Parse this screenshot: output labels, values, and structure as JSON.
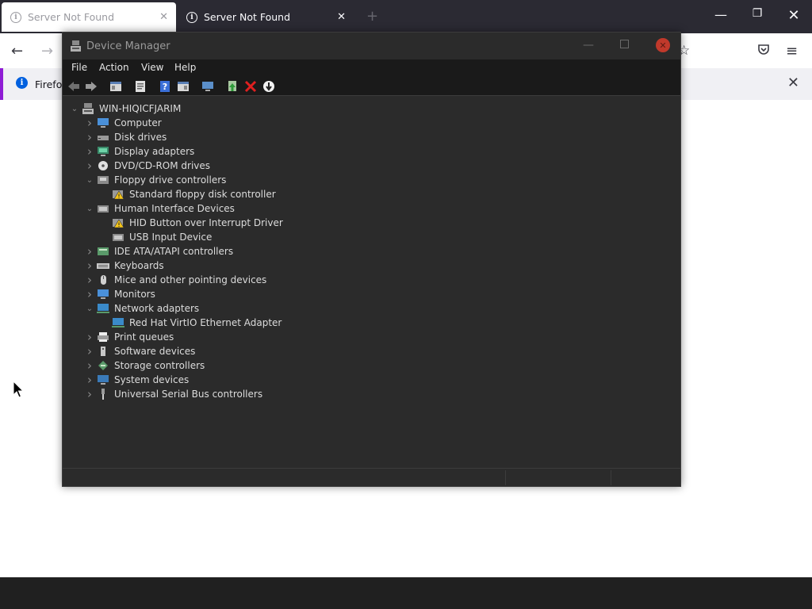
{
  "browser": {
    "tabs": [
      {
        "title": "Server Not Found",
        "active": true
      },
      {
        "title": "Server Not Found",
        "active": false
      }
    ],
    "infobar_text": "Firefox",
    "colors": {
      "tabbar": "#2b2a33",
      "accent": "#8f1cd5"
    }
  },
  "device_manager": {
    "title": "Device Manager",
    "menu": [
      "File",
      "Action",
      "View",
      "Help"
    ],
    "toolbar_icons": [
      "back-arrow-icon",
      "forward-arrow-icon",
      "show-hide-console-tree-icon",
      "properties-icon",
      "help-icon",
      "action-pane-icon",
      "scan-hardware-icon",
      "update-driver-icon",
      "uninstall-icon",
      "disable-device-icon"
    ],
    "root": "WIN-HIQICFJARIM",
    "tree": [
      {
        "label": "Computer",
        "level": 1,
        "expander": "collapsed",
        "icon": "computer-icon"
      },
      {
        "label": "Disk drives",
        "level": 1,
        "expander": "collapsed",
        "icon": "disk-drive-icon"
      },
      {
        "label": "Display adapters",
        "level": 1,
        "expander": "collapsed",
        "icon": "display-adapter-icon"
      },
      {
        "label": "DVD/CD-ROM drives",
        "level": 1,
        "expander": "collapsed",
        "icon": "dvd-icon"
      },
      {
        "label": "Floppy drive controllers",
        "level": 1,
        "expander": "expanded",
        "icon": "floppy-controller-icon"
      },
      {
        "label": "Standard floppy disk controller",
        "level": 2,
        "expander": "none",
        "icon": "warning-device-icon"
      },
      {
        "label": "Human Interface Devices",
        "level": 1,
        "expander": "expanded",
        "icon": "hid-icon"
      },
      {
        "label": "HID Button over Interrupt Driver",
        "level": 2,
        "expander": "none",
        "icon": "warning-device-icon"
      },
      {
        "label": "USB Input Device",
        "level": 2,
        "expander": "none",
        "icon": "hid-icon"
      },
      {
        "label": "IDE ATA/ATAPI controllers",
        "level": 1,
        "expander": "collapsed",
        "icon": "ide-controller-icon"
      },
      {
        "label": "Keyboards",
        "level": 1,
        "expander": "collapsed",
        "icon": "keyboard-icon"
      },
      {
        "label": "Mice and other pointing devices",
        "level": 1,
        "expander": "collapsed",
        "icon": "mouse-icon"
      },
      {
        "label": "Monitors",
        "level": 1,
        "expander": "collapsed",
        "icon": "monitor-icon"
      },
      {
        "label": "Network adapters",
        "level": 1,
        "expander": "expanded",
        "icon": "network-adapter-icon"
      },
      {
        "label": "Red Hat VirtIO Ethernet Adapter",
        "level": 2,
        "expander": "none",
        "icon": "network-adapter-icon"
      },
      {
        "label": "Print queues",
        "level": 1,
        "expander": "collapsed",
        "icon": "printer-icon"
      },
      {
        "label": "Software devices",
        "level": 1,
        "expander": "collapsed",
        "icon": "software-device-icon"
      },
      {
        "label": "Storage controllers",
        "level": 1,
        "expander": "collapsed",
        "icon": "storage-controller-icon"
      },
      {
        "label": "System devices",
        "level": 1,
        "expander": "collapsed",
        "icon": "system-devices-icon"
      },
      {
        "label": "Universal Serial Bus controllers",
        "level": 1,
        "expander": "collapsed",
        "icon": "usb-icon"
      }
    ],
    "colors": {
      "window": "#2b2b2b",
      "menubar": "#1a1a1a",
      "text": "#dcdcdc",
      "close": "#c0392b"
    }
  }
}
